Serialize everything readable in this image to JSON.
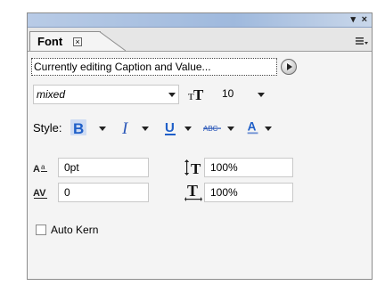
{
  "panel": {
    "title_buttons": {
      "collapse": "▾",
      "close": "×"
    },
    "tab": {
      "label": "Font",
      "close_glyph": "×"
    },
    "editing_status": "Currently editing Caption and Value...",
    "font_family": {
      "value": "mixed"
    },
    "font_size": {
      "value": "10"
    },
    "style": {
      "label": "Style:"
    },
    "tracking": {
      "value": "0pt"
    },
    "vertical_scale": {
      "value": "100%"
    },
    "kerning": {
      "value": "0"
    },
    "horizontal_scale": {
      "value": "100%"
    },
    "auto_kern": {
      "label": "Auto Kern",
      "checked": false
    }
  },
  "icons": [
    "panel-menu-icon",
    "play-icon",
    "font-size-icon",
    "bold-icon",
    "italic-icon",
    "underline-icon",
    "strikethrough-icon",
    "font-color-icon",
    "tracking-icon",
    "vertical-scale-icon",
    "kerning-icon",
    "horizontal-scale-icon"
  ],
  "colors": {
    "bold_blue": "#1f5fc8",
    "italic_blue": "#2a57b8",
    "titlebar": "#a9c0e0"
  }
}
